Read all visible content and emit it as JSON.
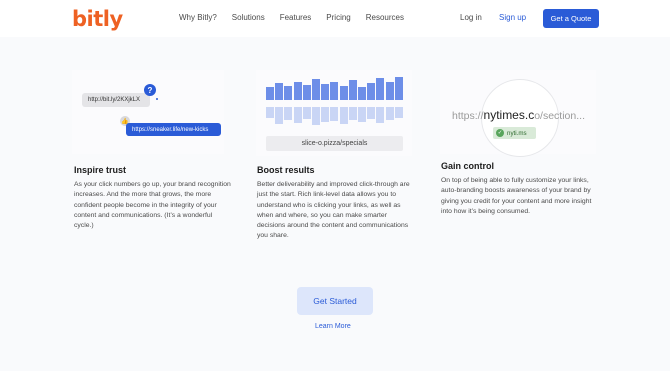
{
  "header": {
    "logo": "bitly",
    "nav": [
      "Why Bitly?",
      "Solutions",
      "Features",
      "Pricing",
      "Resources"
    ],
    "login": "Log in",
    "signup": "Sign up",
    "cta": "Get a Quote",
    "brand_color": "#ee6123",
    "accent_color": "#2a5bd7"
  },
  "cards": [
    {
      "title": "Inspire trust",
      "body": "As your click numbers go up, your brand recognition increases. And the more that grows, the more confident people become in the integrity of your content and communications. (It’s a wonderful cycle.)",
      "illustration": {
        "generic_link": "http://bit.ly/2KXjkLX",
        "question_mark": "?",
        "branded_link": "https://sneaker.life/new-kicks",
        "icons": [
          "question-icon",
          "thumbs-up-icon"
        ]
      }
    },
    {
      "title": "Boost results",
      "body": "Better deliverability and improved click-through are just the start. Rich link-level data allows you to understand who is clicking your links, as well as when and where, so you can make smarter decisions around the content and communications you share.",
      "illustration": {
        "short_link": "slice-o.pizza/specials",
        "bars_top": [
          0.55,
          0.75,
          0.6,
          0.8,
          0.65,
          0.9,
          0.7,
          0.8,
          0.6,
          0.85,
          0.55,
          0.75,
          0.95,
          0.8,
          1.0
        ],
        "bars_bottom": [
          0.5,
          0.8,
          0.6,
          0.75,
          0.55,
          0.85,
          0.7,
          0.65,
          0.8,
          0.6,
          0.7,
          0.55,
          0.75,
          0.6,
          0.5
        ]
      }
    },
    {
      "title": "Gain control",
      "body": "On top of being able to fully customize your links, auto-branding boosts awareness of your brand by giving you credit for your content and more insight into how it’s being consumed.",
      "illustration": {
        "prefix": "https://",
        "domain": "nytimes.c",
        "suffix": "o/section...",
        "badge": "nyti.ms",
        "icons": [
          "check-icon"
        ]
      }
    }
  ],
  "footer_cta": {
    "button": "Get Started",
    "link": "Learn More"
  }
}
